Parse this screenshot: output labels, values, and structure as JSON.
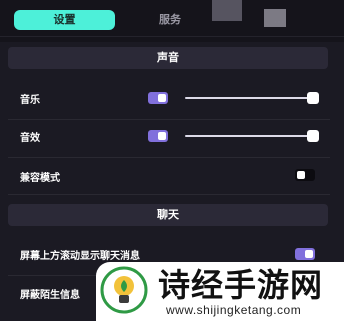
{
  "tabs": [
    {
      "label": "设置",
      "active": true
    },
    {
      "label": "服务",
      "active": false
    },
    {
      "label": "…",
      "active": false
    }
  ],
  "sections": {
    "sound": {
      "title": "声音",
      "music": {
        "label": "音乐",
        "enabled": true,
        "volume": 1.0
      },
      "sfx": {
        "label": "音效",
        "enabled": true,
        "volume": 1.0
      },
      "compat": {
        "label": "兼容模式",
        "enabled": false
      }
    },
    "chat": {
      "title": "聊天",
      "scroll": {
        "label": "屏幕上方滚动显示聊天消息",
        "enabled": true
      },
      "block": {
        "label": "屏蔽陌生信息"
      }
    }
  },
  "watermark": {
    "title": "诗经手游网",
    "url": "www.shijingketang.com"
  },
  "colors": {
    "accent_tab": "#4df0d9",
    "toggle_on": "#8170dc",
    "background": "#1b1a23",
    "section_header": "#2b2937"
  }
}
